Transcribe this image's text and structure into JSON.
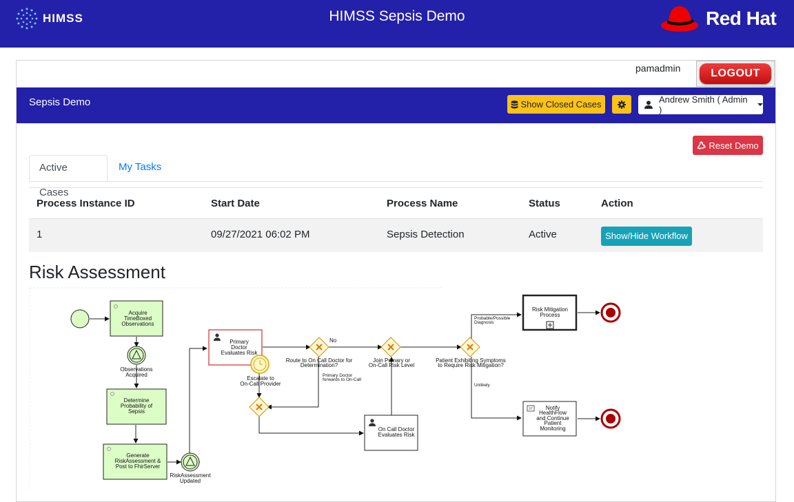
{
  "header": {
    "brand_left": "HIMSS",
    "title": "HIMSS Sepsis Demo",
    "brand_right": "Red Hat"
  },
  "user": {
    "username": "pamadmin",
    "logout_label": "LOGOUT"
  },
  "subbar": {
    "title": "Sepsis Demo",
    "show_closed_label": "Show Closed Cases",
    "user_menu_label": "Andrew Smith ( Admin )"
  },
  "reset_label": "Reset Demo",
  "tabs": [
    {
      "label": "Active Cases",
      "active": true
    },
    {
      "label": "My Tasks",
      "active": false
    }
  ],
  "table": {
    "columns": [
      "Process Instance ID",
      "Start Date",
      "Process Name",
      "Status",
      "Action"
    ],
    "rows": [
      {
        "id": "1",
        "start_date": "09/27/2021 06:02 PM",
        "process_name": "Sepsis Detection",
        "status": "Active",
        "action_label": "Show/Hide Workflow"
      }
    ]
  },
  "section_title": "Risk Assessment",
  "diagram": {
    "tasks": {
      "acquire": [
        "Acquire",
        "TimeBoxed",
        "Observations"
      ],
      "determine": [
        "Determine",
        "Probability of",
        "Sepsis"
      ],
      "generate": [
        "Generate",
        "RiskAssessment &",
        "Post to FhirServer"
      ],
      "primary_doctor": [
        "Primary",
        "Doctor",
        "Evaluates Risk"
      ],
      "oncall_doctor": [
        "On Call Doctor",
        "Evaluates Risk"
      ],
      "risk_mitigation": [
        "Risk Mitigation",
        "Process"
      ],
      "notify": [
        "Notify",
        "HealthFlow",
        "and Continue",
        "Patient",
        "Monitoring"
      ]
    },
    "events": {
      "observations_acquired": [
        "Observations",
        "Acquired"
      ],
      "risk_assessment_updated": [
        "RiskAssessment",
        "Updated"
      ],
      "escalate": [
        "Escalate to",
        "On-Call Provider"
      ]
    },
    "gateways": {
      "route": [
        "Route to On Call Doctor for",
        "Determination?"
      ],
      "join": [
        "Join Primary or",
        "On-Call Risk Level"
      ],
      "patient": [
        "Patient Exhibiting Symptoms",
        "to Require Risk Mitigation?"
      ]
    },
    "flow_labels": {
      "no": "No",
      "forwards": [
        "Primary Doctor",
        "forwards to On-Call"
      ],
      "probable": [
        "Probable/Possible",
        "Diagnosis"
      ],
      "unlikely": "Unlikely"
    }
  }
}
